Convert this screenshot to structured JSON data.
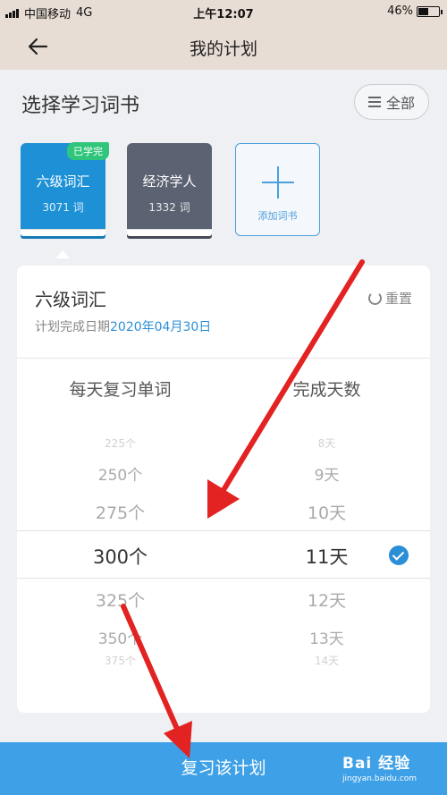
{
  "status_bar": {
    "carrier": "中国移动",
    "network": "4G",
    "time": "上午12:07",
    "battery": "46%"
  },
  "nav": {
    "title": "我的计划"
  },
  "books_section": {
    "title": "选择学习词书",
    "all_button": "全部"
  },
  "books": [
    {
      "name": "六级词汇",
      "count": "3071 词",
      "badge": "已学完"
    },
    {
      "name": "经济学人",
      "count": "1332 词"
    }
  ],
  "add_book": {
    "label": "添加词书"
  },
  "plan": {
    "name": "六级词汇",
    "reset_label": "重置",
    "date_prefix": "计划完成日期",
    "date_value": "2020年04月30日",
    "daily_header": "每天复习单词",
    "days_header": "完成天数",
    "daily_options": [
      "225个",
      "250个",
      "275个",
      "300个",
      "325个",
      "350个",
      "375个"
    ],
    "day_options": [
      "8天",
      "9天",
      "10天",
      "11天",
      "12天",
      "13天",
      "14天"
    ],
    "selected_daily": "300个",
    "selected_days": "11天"
  },
  "bottom_button": "复习该计划",
  "watermark": {
    "main": "Bai 经验",
    "sub": "jingyan.baidu.com"
  },
  "colors": {
    "accent": "#2b8fd6",
    "button": "#3ea0e6",
    "badge": "#2fc57a",
    "arrow": "#e32222"
  }
}
